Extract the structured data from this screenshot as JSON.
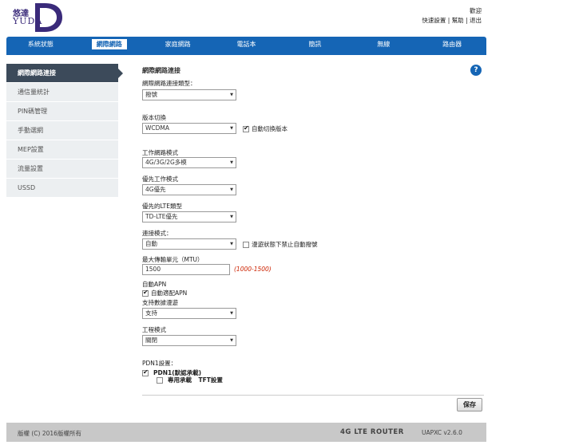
{
  "logo": {
    "chinese": "悠達",
    "english": "YUDA"
  },
  "header": {
    "welcome": "歡迎",
    "quick_setup": "快速設置",
    "help": "幫助",
    "logout": "退出",
    "sep": "|"
  },
  "nav": [
    "系統狀態",
    "網際網路",
    "家庭網路",
    "電話本",
    "簡訊",
    "無線",
    "路由器"
  ],
  "sidebar": [
    "網際網路連接",
    "通信量統計",
    "PIN碼管理",
    "手動選網",
    "MEP設置",
    "流量設置",
    "USSD"
  ],
  "main": {
    "title": "網際網路連接",
    "conn_type_label": "網際網路連接類型：",
    "conn_type_value": "撥號",
    "version_label": "版本切換",
    "version_value": "WCDMA",
    "auto_switch_label": "自動切換版本",
    "work_mode_label": "工作網路模式",
    "work_mode_value": "4G/3G/2G多模",
    "priority_label": "優先工作模式",
    "priority_value": "4G優先",
    "lte_label": "優先的LTE類型",
    "lte_value": "TD-LTE優先",
    "connect_mode_label": "連接模式：",
    "connect_mode_value": "自動",
    "roaming_label": "漫遊狀態下禁止自動撥號",
    "mtu_label": "最大傳輸單元（MTU）",
    "mtu_value": "1500",
    "mtu_range": "(1000-1500)",
    "auto_apn_label": "自動APN",
    "auto_apn_check_label": "自動適配APN",
    "data_roaming_label": "支持數據漫遊",
    "data_roaming_value": "支持",
    "eng_mode_label": "工程模式",
    "eng_mode_value": "關閉",
    "pdn_label": "PDN1設置：",
    "pdn1_label": "PDN1(默認承載)",
    "dedicated_label": "專用承載",
    "tft_label": "TFT設置",
    "save": "保存"
  },
  "help_icon": "?",
  "footer": {
    "copyright": "版權 (C) 2016版權所有",
    "product": "4G LTE ROUTER",
    "version": "UAPXC v2.6.0"
  },
  "colors": {
    "nav_blue": "#1565b5",
    "sidebar_active": "#3c4a5a",
    "range_red": "#cc2200"
  }
}
